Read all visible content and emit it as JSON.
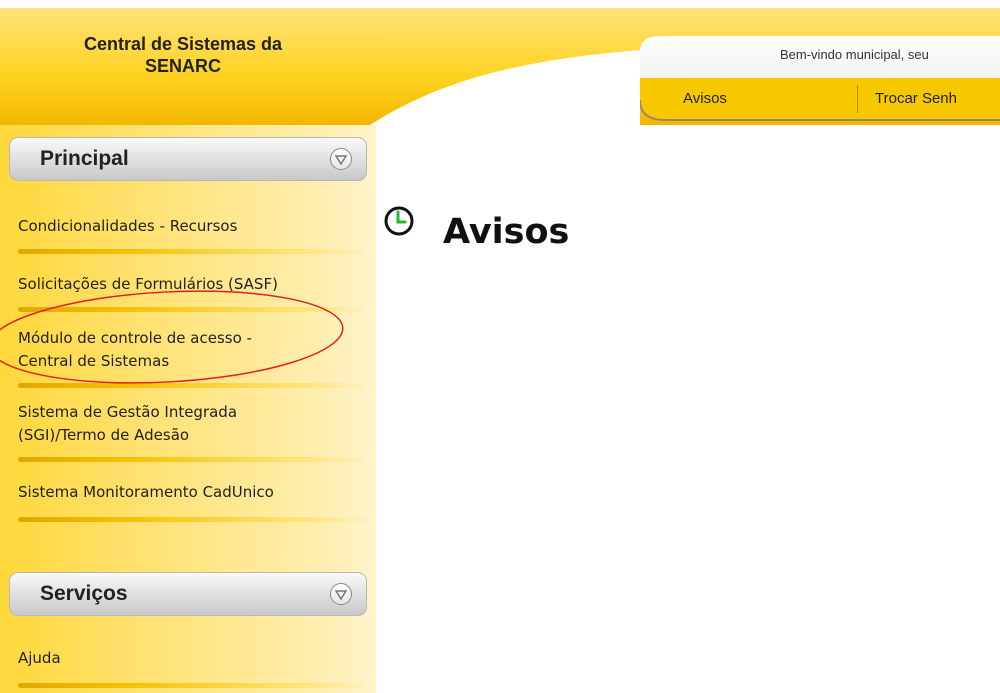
{
  "header": {
    "app_title_line1": "Central de Sistemas da",
    "app_title_line2": "SENARC",
    "welcome_text": "Bem-vindo municipal, seu",
    "links": [
      "Avisos",
      "Trocar Senh"
    ]
  },
  "sidebar": {
    "principal": {
      "title": "Principal",
      "items": [
        [
          "Condicionalidades - Recursos"
        ],
        [
          "Solicitações de Formulários (SASF)"
        ],
        [
          "Módulo de controle de acesso -",
          "Central de Sistemas"
        ],
        [
          "Sistema de Gestão Integrada",
          "(SGI)/Termo de Adesão"
        ],
        [
          "Sistema Monitoramento CadUnico"
        ]
      ]
    },
    "servicos": {
      "title": "Serviços",
      "items": [
        [
          "Ajuda"
        ]
      ]
    }
  },
  "main": {
    "page_title": "Avisos"
  },
  "colors": {
    "brand_yellow": "#ffd100",
    "annotation_red": "#e41e1e"
  },
  "icons": {
    "clock": "clock-icon",
    "collapse": "chevron-down-icon"
  }
}
